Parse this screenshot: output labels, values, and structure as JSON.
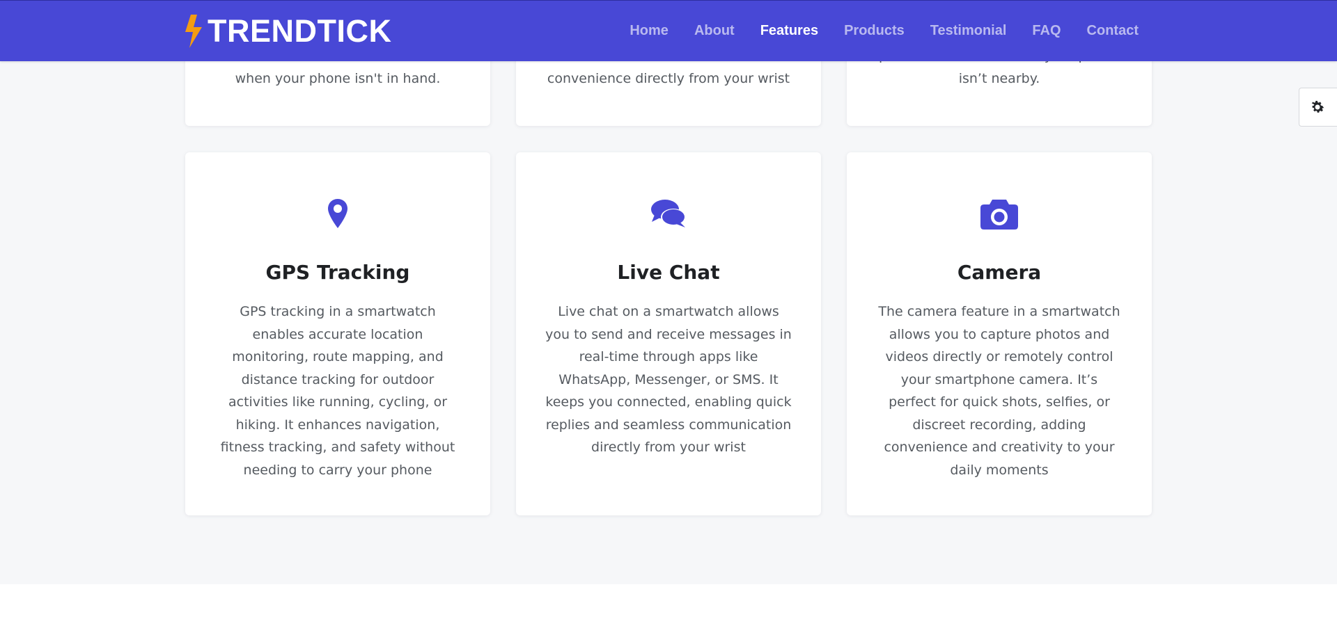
{
  "brand": {
    "name": "TRENDTICK",
    "accent": "#f39c12",
    "primary": "#4848d6"
  },
  "nav": {
    "items": [
      {
        "label": "Home"
      },
      {
        "label": "About"
      },
      {
        "label": "Features",
        "active": true
      },
      {
        "label": "Products"
      },
      {
        "label": "Testimonial"
      },
      {
        "label": "FAQ"
      },
      {
        "label": "Contact"
      }
    ]
  },
  "settings": {
    "icon": "gear-icon"
  },
  "features_top": [
    {
      "desc": "when your phone isn't in hand."
    },
    {
      "desc": "convenience directly from your wrist"
    },
    {
      "desc": "performance even when your phone isn’t nearby."
    }
  ],
  "features": [
    {
      "icon": "map-marker-icon",
      "title": "GPS Tracking",
      "desc": "GPS tracking in a smartwatch enables accurate location monitoring, route mapping, and distance tracking for outdoor activities like running, cycling, or hiking. It enhances navigation, fitness tracking, and safety without needing to carry your phone"
    },
    {
      "icon": "chat-bubbles-icon",
      "title": "Live Chat",
      "desc": "Live chat on a smartwatch allows you to send and receive messages in real-time through apps like WhatsApp, Messenger, or SMS. It keeps you connected, enabling quick replies and seamless communication directly from your wrist"
    },
    {
      "icon": "camera-icon",
      "title": "Camera",
      "desc": "The camera feature in a smartwatch allows you to capture photos and videos directly or remotely control your smartphone camera. It’s perfect for quick shots, selfies, or discreet recording, adding convenience and creativity to your daily moments"
    }
  ]
}
